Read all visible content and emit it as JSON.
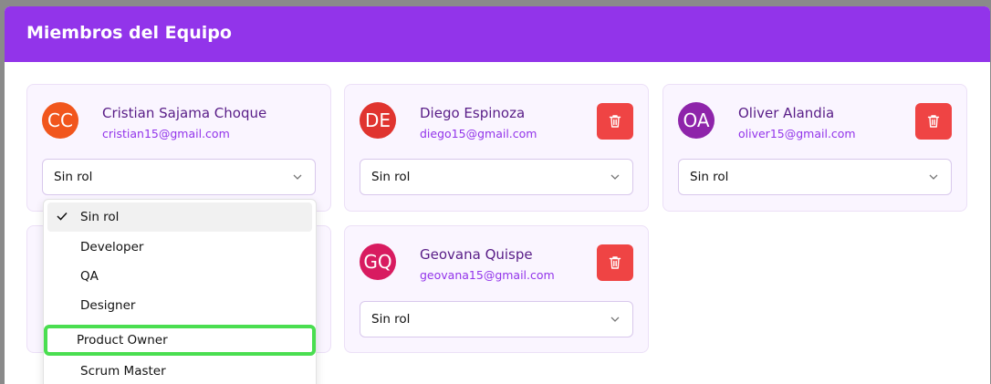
{
  "panel": {
    "title": "Miembros del Equipo"
  },
  "members": [
    {
      "initials": "CC",
      "name": "Cristian Sajama Choque",
      "email": "cristian15@gmail.com",
      "avatar_color": "#f1561d",
      "role": "Sin rol"
    },
    {
      "initials": "DE",
      "name": "Diego Espinoza",
      "email": "diego15@gmail.com",
      "avatar_color": "#e0342f",
      "role": "Sin rol"
    },
    {
      "initials": "OA",
      "name": "Oliver Alandia",
      "email": "oliver15@gmail.com",
      "avatar_color": "#8e24aa",
      "role": "Sin rol"
    },
    {
      "initials": "GQ",
      "name": "Geovana Quispe",
      "email": "geovana15@gmail.com",
      "avatar_color": "#d81b60",
      "role": "Sin rol"
    }
  ],
  "role_dropdown": {
    "options": [
      "Sin rol",
      "Developer",
      "QA",
      "Designer",
      "Product Owner",
      "Scrum Master"
    ],
    "selected": "Sin rol",
    "highlighted": "Product Owner"
  },
  "colors": {
    "header": "#9234ea",
    "delete": "#ef4444",
    "highlight_ring": "#4ade50"
  }
}
